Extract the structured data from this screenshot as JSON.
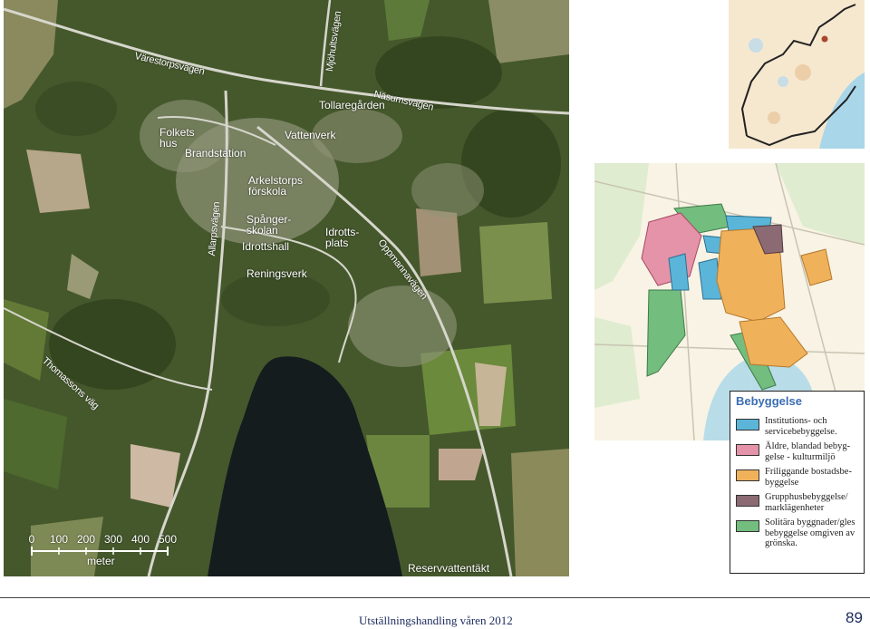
{
  "aerial_labels": {
    "varestorpsvagen": "Värestorpsvägen",
    "mjohultsvagen": "Mjöhultsvägen",
    "tollaregarden": "Tollaregården",
    "nasumsvagen": "Näsumsvägen",
    "folkets_hus": "Folkets hus",
    "brandstation": "Brandstation",
    "vattenverk": "Vattenverk",
    "arkelstorps_forskola": "Arkelstorps förskola",
    "allarpsvagen": "Allarpsvägen",
    "spangerskolan": "Spånger- skolan",
    "idrottshall": "Idrottshall",
    "idrottsplats": "Idrotts- plats",
    "oppmannavagen": "Oppmannavägen",
    "reningsverk": "Reningsverk",
    "thomassons_vag": "Thomassons väg",
    "reservvattentakt": "Reservvattentäkt"
  },
  "scale": {
    "ticks": [
      "0",
      "100",
      "200",
      "300",
      "400",
      "500"
    ],
    "unit": "meter"
  },
  "legend": {
    "title": "Bebyggelse",
    "items": [
      {
        "label": "Institutions- och servicebebyggelse.",
        "color": "#5ab5d9"
      },
      {
        "label": "Äldre, blandad bebyg- gelse - kulturmiljö",
        "color": "#e493a9"
      },
      {
        "label": "Friliggande bostadsbe- byggelse",
        "color": "#f0b15b"
      },
      {
        "label": "Grupphusbebyggelse/ marklägenheter",
        "color": "#8b6a73"
      },
      {
        "label": "Solitära byggnader/gles bebyggelse omgiven av grönska.",
        "color": "#73bd7e"
      }
    ]
  },
  "footer": {
    "text": "Utställningshandling våren 2012",
    "page_number": "89"
  }
}
